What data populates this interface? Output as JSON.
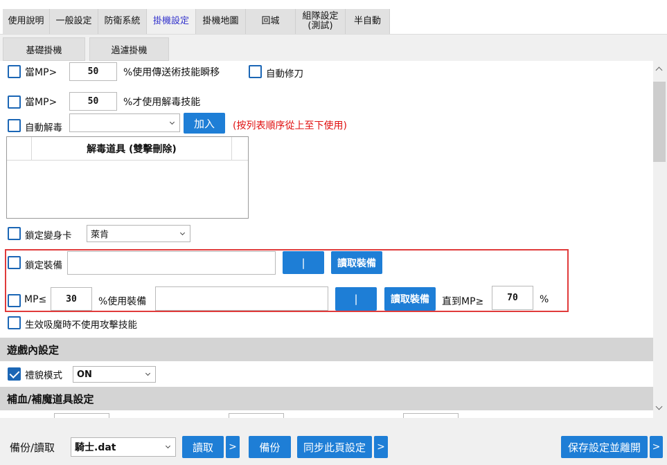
{
  "tabs": [
    {
      "label": "使用說明"
    },
    {
      "label": "一般設定"
    },
    {
      "label": "防衛系統"
    },
    {
      "label": "掛機設定"
    },
    {
      "label": "掛機地圖"
    },
    {
      "label": "回城"
    },
    {
      "label": "組隊設定\n(測試)"
    },
    {
      "label": "半自動"
    }
  ],
  "subtabs": [
    {
      "label": "基礎掛機"
    },
    {
      "label": "過濾掛機"
    }
  ],
  "panel": {
    "mp_teleport": {
      "prefix": "當MP>",
      "value": "50",
      "suffix": "%使用傳送術技能瞬移"
    },
    "auto_sword": {
      "label": "自動修刀"
    },
    "mp_cure": {
      "prefix": "當MP>",
      "value": "50",
      "suffix": "%才使用解毒技能"
    },
    "auto_cure": {
      "label": "自動解毒",
      "add_label": "加入",
      "note": "(按列表順序從上至下使用)"
    },
    "cure_list": {
      "header": "解毒道具 (雙擊刪除)"
    },
    "lock_poly": {
      "label": "鎖定變身卡",
      "selected": "萊肯"
    },
    "lock_equip": {
      "label": "鎖定裝備",
      "sep_label": "|",
      "read_label": "讀取裝備"
    },
    "mp_equip": {
      "prefix": "MP≤",
      "value": "30",
      "mid": "%使用裝備",
      "sep_label": "|",
      "read_label": "讀取裝備",
      "until": "直到MP≥",
      "until_value": "70",
      "pct": "%"
    },
    "no_attack_drain": {
      "label": "生效吸魔時不使用攻擊技能"
    },
    "section_game": "遊戲內設定",
    "polite_mode": {
      "label": "禮貌模式",
      "selected": "ON"
    },
    "section_potion": "補血/補魔道具設定"
  },
  "bottom": {
    "backup_label": "備份/讀取",
    "file": "騎士.dat",
    "read_label": "讀取",
    "chev1": ">",
    "backup_btn": "備份",
    "sync_label": "同步此頁設定",
    "chev2": ">",
    "save_exit_label": "保存設定並離開",
    "chev3": ">"
  }
}
